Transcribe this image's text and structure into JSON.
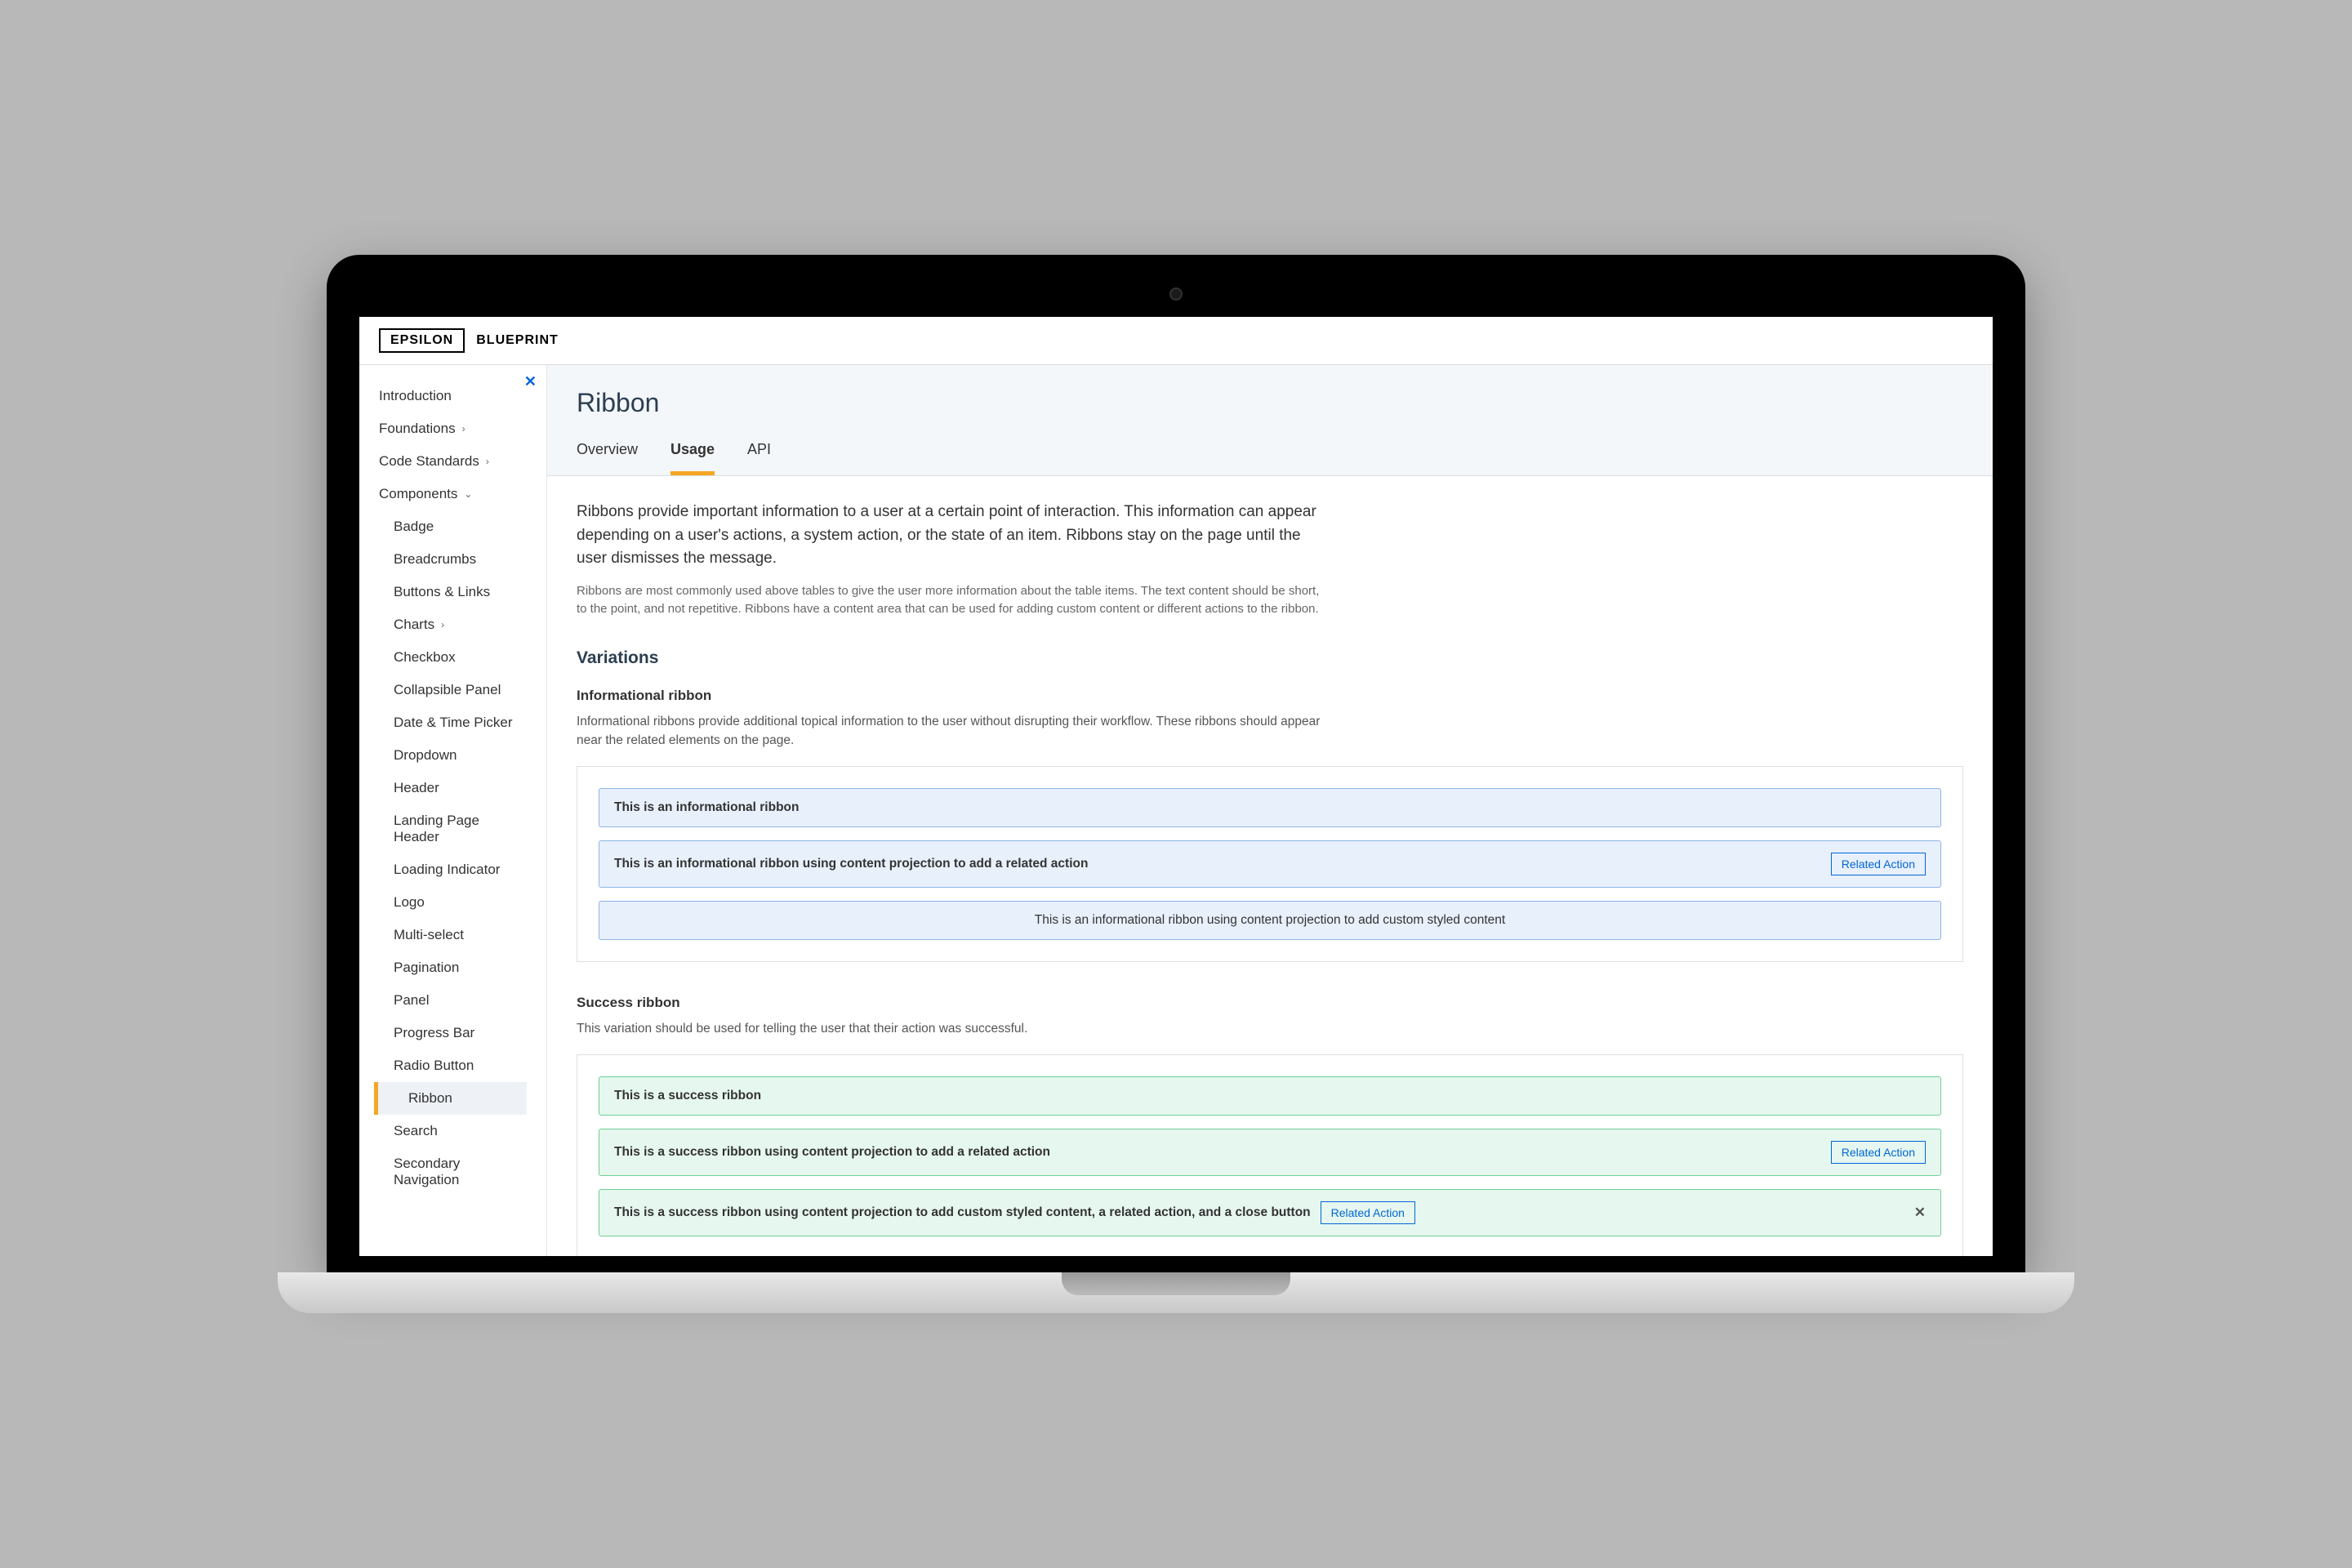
{
  "logo": {
    "box": "EPSILON",
    "text": "BLUEPRINT"
  },
  "nav": {
    "top": [
      {
        "label": "Introduction"
      },
      {
        "label": "Foundations",
        "expand": true
      },
      {
        "label": "Code Standards",
        "expand": true
      },
      {
        "label": "Components",
        "expand": true,
        "open": true
      }
    ],
    "components": [
      "Badge",
      "Breadcrumbs",
      "Buttons & Links",
      "Charts",
      "Checkbox",
      "Collapsible Panel",
      "Date & Time Picker",
      "Dropdown",
      "Header",
      "Landing Page Header",
      "Loading Indicator",
      "Logo",
      "Multi-select",
      "Pagination",
      "Panel",
      "Progress Bar",
      "Radio Button",
      "Ribbon",
      "Search",
      "Secondary Navigation"
    ],
    "active": "Ribbon",
    "charts_expand": true
  },
  "page": {
    "title": "Ribbon",
    "tabs": [
      "Overview",
      "Usage",
      "API"
    ],
    "active_tab": "Usage",
    "intro": "Ribbons provide important information to a user at a certain point of interaction. This information can appear depending on a user's actions, a system action, or the state of an item. Ribbons stay on the page until the user dismisses the message.",
    "sub_intro": "Ribbons are most commonly used above tables to give the user more information about the table items. The text content should be short, to the point, and not repetitive. Ribbons have a content area that can be used for adding custom content or different actions to the ribbon.",
    "variations_heading": "Variations",
    "info": {
      "heading": "Informational ribbon",
      "desc": "Informational ribbons provide additional topical information to the user without disrupting their workflow. These ribbons should appear near the related elements on the page.",
      "r1": "This is an informational ribbon",
      "r2": "This is an informational ribbon using content projection to add a related action",
      "r3": "This is an informational ribbon using content projection to add custom styled content"
    },
    "success": {
      "heading": "Success ribbon",
      "desc": "This variation should be used for telling the user that their action was successful.",
      "r1": "This is a success ribbon",
      "r2": "This is a success ribbon using content projection to add a related action",
      "r3": "This is a success ribbon using content projection to add custom styled content, a related action, and a close button"
    },
    "action_label": "Related Action"
  }
}
